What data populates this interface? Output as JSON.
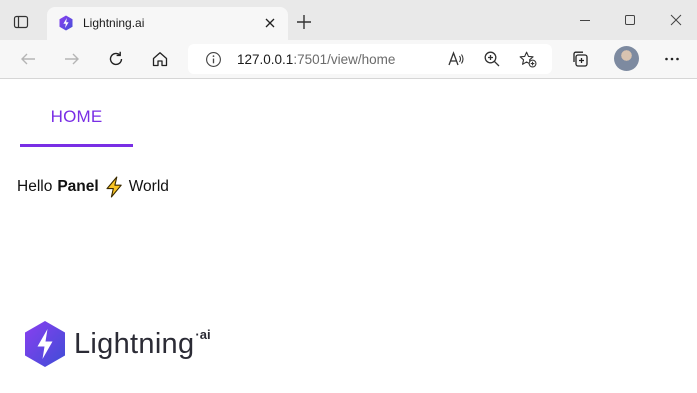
{
  "browser": {
    "tab": {
      "title": "Lightning.ai",
      "favicon": "lightning-logo-icon"
    },
    "address": {
      "host": "127.0.0.1",
      "rest": ":7501/view/home"
    },
    "icons": {
      "back": "arrow-left-icon",
      "forward": "arrow-right-icon",
      "reload": "refresh-icon",
      "home": "home-icon",
      "read_aloud": "read-aloud-icon",
      "zoom": "zoom-icon",
      "favorite": "add-favorite-icon",
      "collections": "collections-icon",
      "menu": "more-icon"
    }
  },
  "app": {
    "nav": {
      "tabs": [
        {
          "label": "HOME",
          "active": true
        }
      ]
    },
    "content": {
      "hello": "Hello",
      "bold": "Panel",
      "world": "World"
    },
    "logo": {
      "text": "Lightning",
      "suffix": "ai"
    }
  },
  "colors": {
    "accent": "#792ee5",
    "logo_gradient_start": "#792ee5",
    "logo_gradient_end": "#3e4dd6"
  }
}
